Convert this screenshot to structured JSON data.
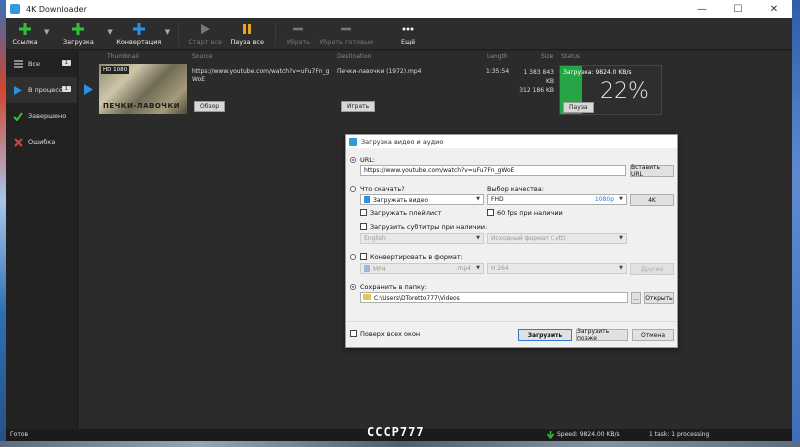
{
  "window": {
    "title": "4K Downloader",
    "controls": [
      "—",
      "☐",
      "✕"
    ]
  },
  "toolbar": {
    "link": "Ссылка",
    "download": "Загрузка",
    "convert": "Конвертация",
    "start_all": "Старт все",
    "pause_all": "Пауза все",
    "remove": "Убрать",
    "remove_done": "Убрать готовые",
    "more": "Ещё"
  },
  "sidebar": {
    "items": [
      {
        "label": "Все",
        "badge": "1"
      },
      {
        "label": "В процессе",
        "badge": "1"
      },
      {
        "label": "Завершено"
      },
      {
        "label": "Ошибка"
      }
    ]
  },
  "list": {
    "headers": {
      "thumbnail": "Thumbnail",
      "source": "Source",
      "destination": "Destination",
      "length": "Length",
      "size": "Size",
      "status": "Status"
    },
    "row": {
      "thumb_badge": "HD 1080",
      "thumb_title": "ПЕЧКИ-ЛАВОЧКИ",
      "source": "https://www.youtube.com/watch?v=uFu7Fn_gWoE",
      "destination": "Печки-лавочки (1972).mp4",
      "length": "1:35:54",
      "size_total": "1 383 843 KB",
      "size_done": "312 186 KB",
      "speed": "Загрузка: 9824.0 KB/s",
      "progress": 22,
      "progress_label": "22%",
      "browse": "Обзор",
      "play": "Играть",
      "pause": "Пауза"
    }
  },
  "dialog": {
    "title": "Загрузка видео и аудио",
    "url_label": "URL:",
    "url_value": "https://www.youtube.com/watch?v=uFu7Fn_gWoE",
    "paste_url": "Вставить URL",
    "what_label": "Что скачать?",
    "what_value": "Загружать видео",
    "quality_label": "Выбор качества:",
    "quality_value": "FHD",
    "quality_res": "1080p",
    "btn_4k": "4K",
    "playlist": "Загружать плейлист",
    "fps60": "60 fps при наличии",
    "subtitles": "Загрузить субтитры при наличии:",
    "sub_lang": "English",
    "sub_format": "Исходный формат (.vtt)",
    "convert_label": "Конвертировать в формат:",
    "conv_format": "MP4",
    "conv_ext": ".mp4",
    "conv_codec": "H.264",
    "other": "Другие",
    "save_label": "Сохранить в папку:",
    "save_path": "C:\\Users\\DToretto777\\Videos",
    "browse_dots": "...",
    "open": "Открыть",
    "on_top": "Поверх всех окон",
    "download_btn": "Загрузить",
    "later_btn": "Загрузить позже",
    "cancel_btn": "Отмена"
  },
  "statusbar": {
    "ready": "Готов",
    "speed": "Speed: 9824.00 KB/s",
    "tasks": "1 task: 1 processing"
  },
  "watermark": "СССР777",
  "colors": {
    "accent_green": "#25a545",
    "toolbar_icon_green": "#35c03c",
    "accent_blue": "#2b7ad8",
    "pause_orange": "#f0a020"
  }
}
